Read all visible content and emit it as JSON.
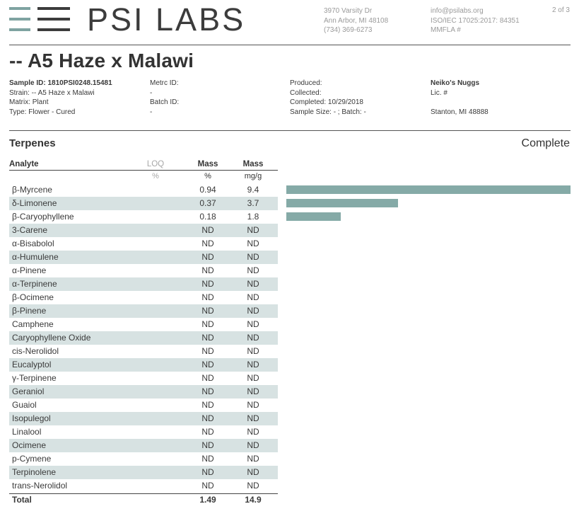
{
  "header": {
    "brand": "PSI LABS",
    "address": [
      "3970 Varsity Dr",
      "Ann Arbor, MI 48108",
      "(734) 369-6273"
    ],
    "contact": [
      "info@psilabs.org",
      "ISO/IEC 17025:2017: 84351",
      "MMFLA #"
    ],
    "page": "2 of 3",
    "colors": {
      "brand_teal": "#7fa3a1",
      "brand_dark": "#3c3c3c"
    }
  },
  "sample": {
    "title": "-- A5 Haze x Malawi",
    "col1": [
      "Sample ID: 1810PSI0248.15481",
      "Strain: -- A5 Haze x Malawi",
      "Matrix: Plant",
      "Type: Flower - Cured"
    ],
    "col2": [
      "Metrc ID:",
      "-",
      "Batch ID:",
      "-"
    ],
    "col3": [
      "Produced:",
      "Collected:",
      "Completed: 10/29/2018",
      "Sample Size: - ; Batch: -"
    ],
    "col4": [
      "Neiko's Nuggs",
      "Lic. #",
      "",
      "Stanton, MI 48888"
    ]
  },
  "terpenes": {
    "section": "Terpenes",
    "status": "Complete",
    "headers": {
      "analyte": "Analyte",
      "loq": "LOQ",
      "mass1": "Mass",
      "mass2": "Mass"
    },
    "units": {
      "loq": "%",
      "mass1": "%",
      "mass2": "mg/g"
    },
    "rows": [
      {
        "name": "β-Myrcene",
        "pct": "0.94",
        "mg": "9.4",
        "bar": 0.94
      },
      {
        "name": "δ-Limonene",
        "pct": "0.37",
        "mg": "3.7",
        "bar": 0.37
      },
      {
        "name": "β-Caryophyllene",
        "pct": "0.18",
        "mg": "1.8",
        "bar": 0.18
      },
      {
        "name": "3-Carene",
        "pct": "ND",
        "mg": "ND",
        "bar": 0
      },
      {
        "name": "α-Bisabolol",
        "pct": "ND",
        "mg": "ND",
        "bar": 0
      },
      {
        "name": "α-Humulene",
        "pct": "ND",
        "mg": "ND",
        "bar": 0
      },
      {
        "name": "α-Pinene",
        "pct": "ND",
        "mg": "ND",
        "bar": 0
      },
      {
        "name": "α-Terpinene",
        "pct": "ND",
        "mg": "ND",
        "bar": 0
      },
      {
        "name": "β-Ocimene",
        "pct": "ND",
        "mg": "ND",
        "bar": 0
      },
      {
        "name": "β-Pinene",
        "pct": "ND",
        "mg": "ND",
        "bar": 0
      },
      {
        "name": "Camphene",
        "pct": "ND",
        "mg": "ND",
        "bar": 0
      },
      {
        "name": "Caryophyllene Oxide",
        "pct": "ND",
        "mg": "ND",
        "bar": 0
      },
      {
        "name": "cis-Nerolidol",
        "pct": "ND",
        "mg": "ND",
        "bar": 0
      },
      {
        "name": "Eucalyptol",
        "pct": "ND",
        "mg": "ND",
        "bar": 0
      },
      {
        "name": "γ-Terpinene",
        "pct": "ND",
        "mg": "ND",
        "bar": 0
      },
      {
        "name": "Geraniol",
        "pct": "ND",
        "mg": "ND",
        "bar": 0
      },
      {
        "name": "Guaiol",
        "pct": "ND",
        "mg": "ND",
        "bar": 0
      },
      {
        "name": "Isopulegol",
        "pct": "ND",
        "mg": "ND",
        "bar": 0
      },
      {
        "name": "Linalool",
        "pct": "ND",
        "mg": "ND",
        "bar": 0
      },
      {
        "name": "Ocimene",
        "pct": "ND",
        "mg": "ND",
        "bar": 0
      },
      {
        "name": "p-Cymene",
        "pct": "ND",
        "mg": "ND",
        "bar": 0
      },
      {
        "name": "Terpinolene",
        "pct": "ND",
        "mg": "ND",
        "bar": 0
      },
      {
        "name": "trans-Nerolidol",
        "pct": "ND",
        "mg": "ND",
        "bar": 0
      }
    ],
    "total": {
      "label": "Total",
      "pct": "1.49",
      "mg": "14.9"
    },
    "bar_color": "#85aaa7",
    "bar_max_pct": 0.94
  }
}
